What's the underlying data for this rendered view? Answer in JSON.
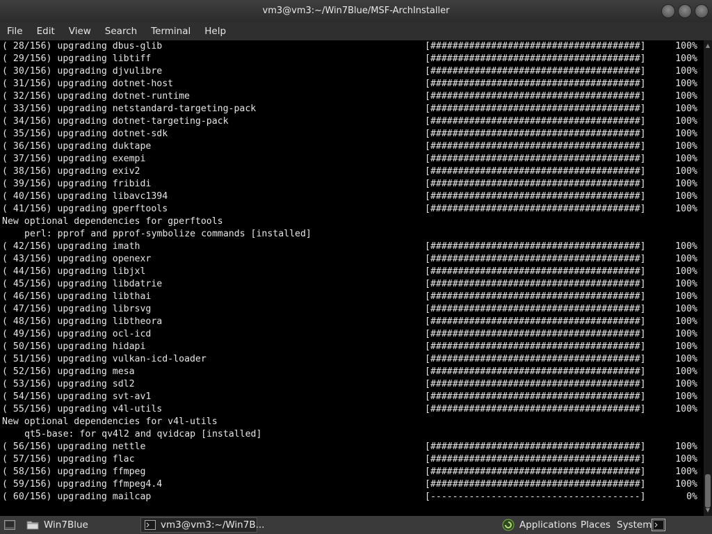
{
  "window": {
    "title": "vm3@vm3:~/Win7Blue/MSF-ArchInstaller"
  },
  "menu": [
    "File",
    "Edit",
    "View",
    "Search",
    "Terminal",
    "Help"
  ],
  "terminal": {
    "lines": [
      {
        "type": "progress",
        "text": "( 28/156) upgrading dbus-glib",
        "bar": "[######################################]",
        "pct": "100%"
      },
      {
        "type": "progress",
        "text": "( 29/156) upgrading libtiff",
        "bar": "[######################################]",
        "pct": "100%"
      },
      {
        "type": "progress",
        "text": "( 30/156) upgrading djvulibre",
        "bar": "[######################################]",
        "pct": "100%"
      },
      {
        "type": "progress",
        "text": "( 31/156) upgrading dotnet-host",
        "bar": "[######################################]",
        "pct": "100%"
      },
      {
        "type": "progress",
        "text": "( 32/156) upgrading dotnet-runtime",
        "bar": "[######################################]",
        "pct": "100%"
      },
      {
        "type": "progress",
        "text": "( 33/156) upgrading netstandard-targeting-pack",
        "bar": "[######################################]",
        "pct": "100%"
      },
      {
        "type": "progress",
        "text": "( 34/156) upgrading dotnet-targeting-pack",
        "bar": "[######################################]",
        "pct": "100%"
      },
      {
        "type": "progress",
        "text": "( 35/156) upgrading dotnet-sdk",
        "bar": "[######################################]",
        "pct": "100%"
      },
      {
        "type": "progress",
        "text": "( 36/156) upgrading duktape",
        "bar": "[######################################]",
        "pct": "100%"
      },
      {
        "type": "progress",
        "text": "( 37/156) upgrading exempi",
        "bar": "[######################################]",
        "pct": "100%"
      },
      {
        "type": "progress",
        "text": "( 38/156) upgrading exiv2",
        "bar": "[######################################]",
        "pct": "100%"
      },
      {
        "type": "progress",
        "text": "( 39/156) upgrading fribidi",
        "bar": "[######################################]",
        "pct": "100%"
      },
      {
        "type": "progress",
        "text": "( 40/156) upgrading libavc1394",
        "bar": "[######################################]",
        "pct": "100%"
      },
      {
        "type": "progress",
        "text": "( 41/156) upgrading gperftools",
        "bar": "[######################################]",
        "pct": "100%"
      },
      {
        "type": "plain",
        "text": "New optional dependencies for gperftools"
      },
      {
        "type": "indent",
        "text": "perl: pprof and pprof-symbolize commands [installed]"
      },
      {
        "type": "progress",
        "text": "( 42/156) upgrading imath",
        "bar": "[######################################]",
        "pct": "100%"
      },
      {
        "type": "progress",
        "text": "( 43/156) upgrading openexr",
        "bar": "[######################################]",
        "pct": "100%"
      },
      {
        "type": "progress",
        "text": "( 44/156) upgrading libjxl",
        "bar": "[######################################]",
        "pct": "100%"
      },
      {
        "type": "progress",
        "text": "( 45/156) upgrading libdatrie",
        "bar": "[######################################]",
        "pct": "100%"
      },
      {
        "type": "progress",
        "text": "( 46/156) upgrading libthai",
        "bar": "[######################################]",
        "pct": "100%"
      },
      {
        "type": "progress",
        "text": "( 47/156) upgrading librsvg",
        "bar": "[######################################]",
        "pct": "100%"
      },
      {
        "type": "progress",
        "text": "( 48/156) upgrading libtheora",
        "bar": "[######################################]",
        "pct": "100%"
      },
      {
        "type": "progress",
        "text": "( 49/156) upgrading ocl-icd",
        "bar": "[######################################]",
        "pct": "100%"
      },
      {
        "type": "progress",
        "text": "( 50/156) upgrading hidapi",
        "bar": "[######################################]",
        "pct": "100%"
      },
      {
        "type": "progress",
        "text": "( 51/156) upgrading vulkan-icd-loader",
        "bar": "[######################################]",
        "pct": "100%"
      },
      {
        "type": "progress",
        "text": "( 52/156) upgrading mesa",
        "bar": "[######################################]",
        "pct": "100%"
      },
      {
        "type": "progress",
        "text": "( 53/156) upgrading sdl2",
        "bar": "[######################################]",
        "pct": "100%"
      },
      {
        "type": "progress",
        "text": "( 54/156) upgrading svt-av1",
        "bar": "[######################################]",
        "pct": "100%"
      },
      {
        "type": "progress",
        "text": "( 55/156) upgrading v4l-utils",
        "bar": "[######################################]",
        "pct": "100%"
      },
      {
        "type": "plain",
        "text": "New optional dependencies for v4l-utils"
      },
      {
        "type": "indent",
        "text": "qt5-base: for qv4l2 and qvidcap [installed]"
      },
      {
        "type": "progress",
        "text": "( 56/156) upgrading nettle",
        "bar": "[######################################]",
        "pct": "100%"
      },
      {
        "type": "progress",
        "text": "( 57/156) upgrading flac",
        "bar": "[######################################]",
        "pct": "100%"
      },
      {
        "type": "progress",
        "text": "( 58/156) upgrading ffmpeg",
        "bar": "[######################################]",
        "pct": "100%"
      },
      {
        "type": "progress",
        "text": "( 59/156) upgrading ffmpeg4.4",
        "bar": "[######################################]",
        "pct": "100%"
      },
      {
        "type": "progress",
        "text": "( 60/156) upgrading mailcap",
        "bar": "[--------------------------------------]",
        "pct": "0%"
      }
    ]
  },
  "taskbar": {
    "folder_label": "Win7Blue",
    "task_label": "vm3@vm3:~/Win7B...",
    "applications": "Applications",
    "places": "Places",
    "system": "System"
  }
}
